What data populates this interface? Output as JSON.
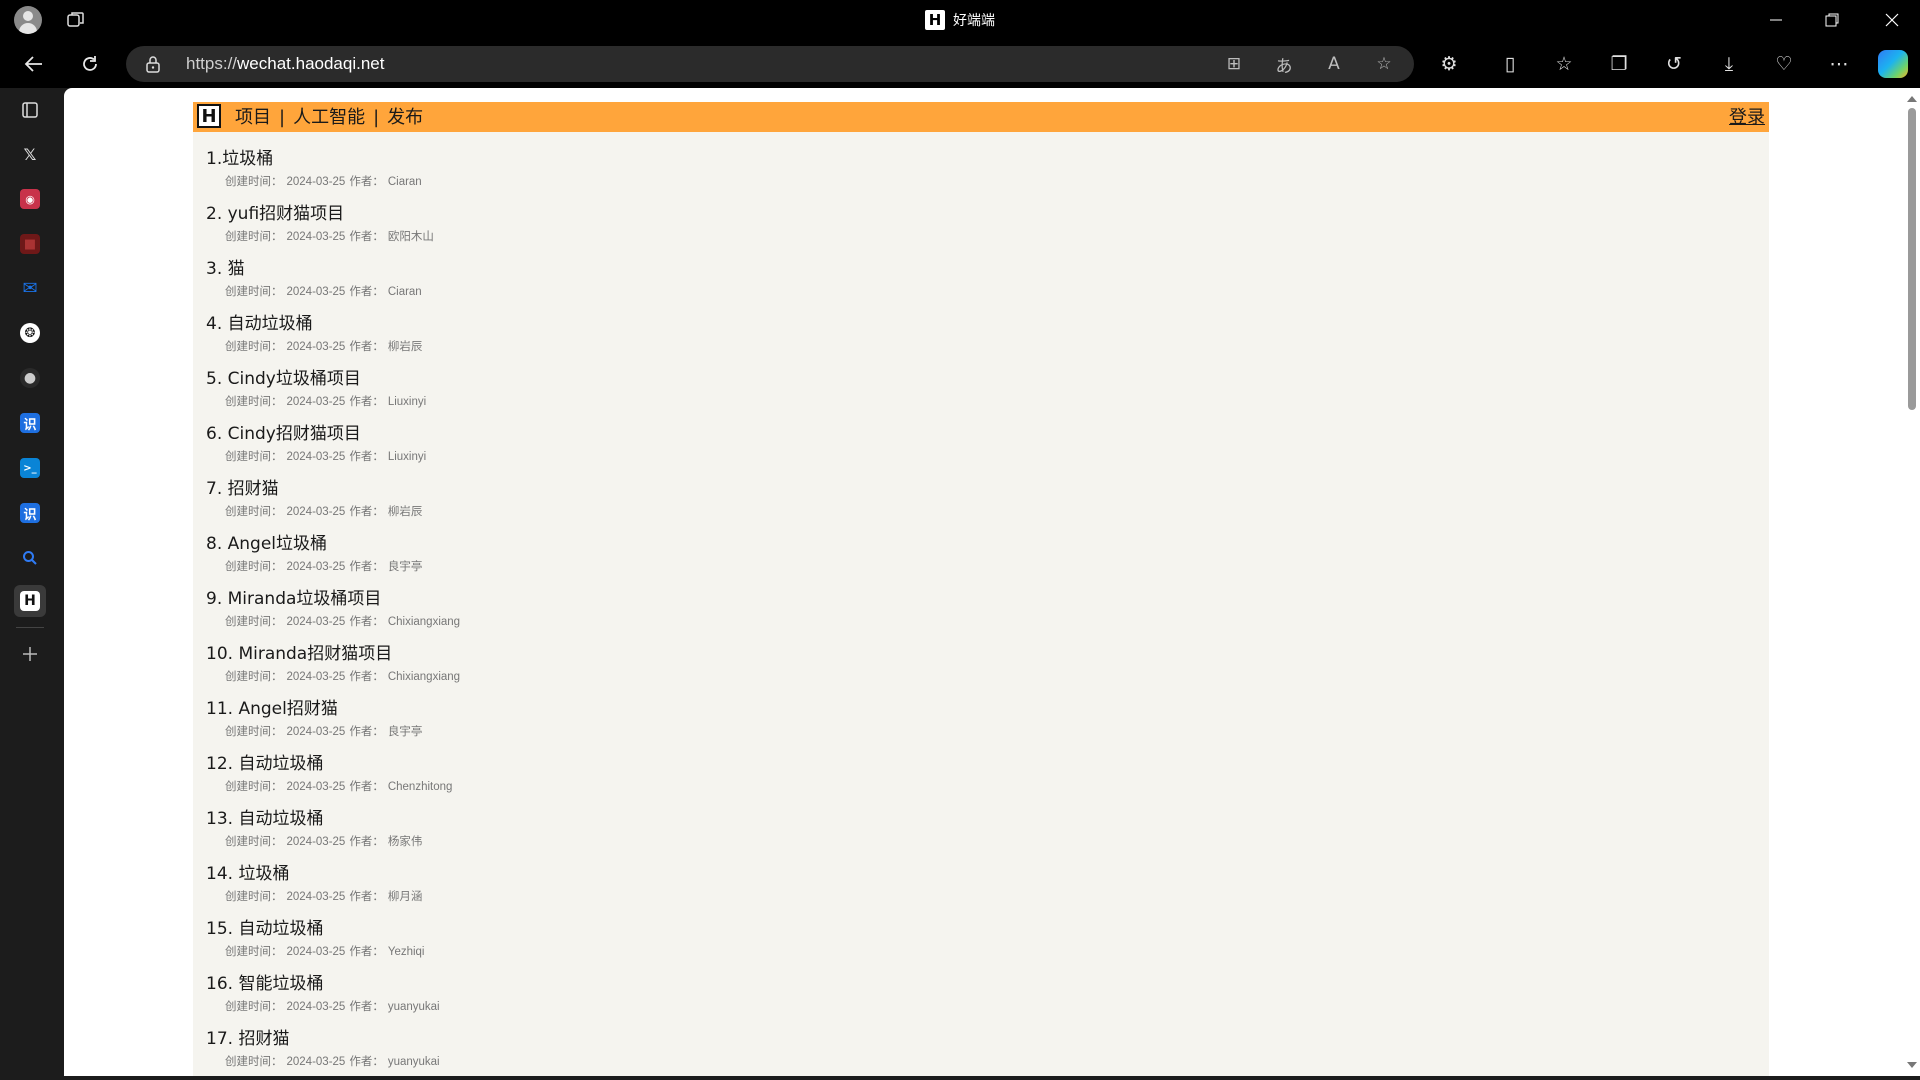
{
  "window": {
    "title": "好端端",
    "title_logo": "H"
  },
  "address_bar": {
    "scheme": "https://",
    "host": "wechat.haodaqi.net"
  },
  "sidebar": {
    "items": [
      {
        "name": "tab-actions",
        "icon": "tabs-icon"
      },
      {
        "name": "x-twitter",
        "icon": "x-icon",
        "glyph": "𝕏"
      },
      {
        "name": "app-red",
        "icon": "app-icon",
        "glyph": "◉",
        "color": "#c8324a"
      },
      {
        "name": "app-darkred",
        "icon": "app-icon",
        "glyph": "◼",
        "color": "#7a1b1b"
      },
      {
        "name": "mail",
        "icon": "mail-icon",
        "glyph": "✉",
        "color": "#1a73e8"
      },
      {
        "name": "openai",
        "icon": "openai-icon",
        "glyph": "❂"
      },
      {
        "name": "github",
        "icon": "github-icon",
        "glyph": "●"
      },
      {
        "name": "shi-1",
        "icon": "translate-icon",
        "glyph": "识",
        "color": "#1e6fe0"
      },
      {
        "name": "terminal",
        "icon": "terminal-icon",
        "glyph": ">_",
        "color": "#0a84d6"
      },
      {
        "name": "shi-2",
        "icon": "translate-icon",
        "glyph": "识",
        "color": "#1e6fe0"
      },
      {
        "name": "search",
        "icon": "search-icon",
        "glyph": "🔍"
      },
      {
        "name": "haodaqi",
        "icon": "h-logo-icon",
        "glyph": "H"
      }
    ]
  },
  "page": {
    "logo": "H",
    "menu": [
      "项目",
      "人工智能",
      "发布"
    ],
    "menu_sep": "|",
    "login": "登录",
    "meta_created_label": "创建时间：",
    "meta_author_label": "作者：",
    "items": [
      {
        "title": "1.垃圾桶",
        "date": "2024-03-25",
        "author": "Ciaran"
      },
      {
        "title": "2. yufi招财猫项目",
        "date": "2024-03-25",
        "author": "欧阳木山"
      },
      {
        "title": "3. 猫",
        "date": "2024-03-25",
        "author": "Ciaran"
      },
      {
        "title": "4. 自动垃圾桶",
        "date": "2024-03-25",
        "author": "柳岩辰"
      },
      {
        "title": "5. Cindy垃圾桶项目",
        "date": "2024-03-25",
        "author": "Liuxinyi"
      },
      {
        "title": "6. Cindy招财猫项目",
        "date": "2024-03-25",
        "author": "Liuxinyi"
      },
      {
        "title": "7. 招财猫",
        "date": "2024-03-25",
        "author": "柳岩辰"
      },
      {
        "title": "8. Angel垃圾桶",
        "date": "2024-03-25",
        "author": "良宇亭"
      },
      {
        "title": "9. Miranda垃圾桶项目",
        "date": "2024-03-25",
        "author": "Chixiangxiang"
      },
      {
        "title": "10. Miranda招财猫项目",
        "date": "2024-03-25",
        "author": "Chixiangxiang"
      },
      {
        "title": "11. Angel招财猫",
        "date": "2024-03-25",
        "author": "良宇亭"
      },
      {
        "title": "12. 自动垃圾桶",
        "date": "2024-03-25",
        "author": "Chenzhitong"
      },
      {
        "title": "13. 自动垃圾桶",
        "date": "2024-03-25",
        "author": "杨家伟"
      },
      {
        "title": "14. 垃圾桶",
        "date": "2024-03-25",
        "author": "柳月涵"
      },
      {
        "title": "15. 自动垃圾桶",
        "date": "2024-03-25",
        "author": "Yezhiqi"
      },
      {
        "title": "16. 智能垃圾桶",
        "date": "2024-03-25",
        "author": "yuanyukai"
      },
      {
        "title": "17. 招财猫",
        "date": "2024-03-25",
        "author": "yuanyukai"
      }
    ]
  },
  "colors": {
    "header_bg": "#ffa53b",
    "content_bg": "#f5f4ef",
    "chrome_bg": "#000000"
  }
}
